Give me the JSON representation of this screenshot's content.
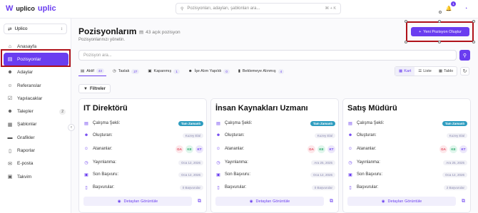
{
  "header": {
    "logo_text_1": "uplico",
    "logo_text_2": "uplic",
    "search_placeholder": "Pozisyonları, adayları, şablonları ara...",
    "search_shortcut": "⌘ + K",
    "notification_count": "1"
  },
  "sidebar": {
    "workspace": "Uplico",
    "items": [
      {
        "label": "Anasayfa",
        "icon": "home-icon"
      },
      {
        "label": "Pozisyonlar",
        "icon": "briefcase-icon"
      },
      {
        "label": "Adaylar",
        "icon": "user-icon"
      },
      {
        "label": "Referanslar",
        "icon": "users-icon"
      },
      {
        "label": "Yapılacaklar",
        "icon": "checklist-icon"
      },
      {
        "label": "Talepler",
        "icon": "user-plus-icon",
        "count": "2"
      },
      {
        "label": "Şablonlar",
        "icon": "template-icon"
      },
      {
        "label": "Grafikler",
        "icon": "chart-icon"
      },
      {
        "label": "Raporlar",
        "icon": "report-icon"
      },
      {
        "label": "E-posta",
        "icon": "mail-icon"
      },
      {
        "label": "Takvim",
        "icon": "calendar-icon"
      }
    ]
  },
  "main": {
    "title": "Pozisyonlarım",
    "open_count": "43 açık pozisyon",
    "subtitle": "Pozisyonlarınızı yönetin.",
    "new_button": "Yeni Pozisyon Oluştur",
    "search_placeholder": "Pozisyon ara...",
    "tabs": [
      {
        "label": "Aktif",
        "count": "43"
      },
      {
        "label": "Taslak",
        "count": "27"
      },
      {
        "label": "Kapanmış",
        "count": "1"
      },
      {
        "label": "İşe Alım Yapıldı",
        "count": "0"
      },
      {
        "label": "Beklemeye Alınmış",
        "count": "4"
      }
    ],
    "views": [
      "Kart",
      "Liste",
      "Tablo"
    ],
    "filters_label": "Filtreler"
  },
  "card_labels": {
    "calisma": "Çalışma Şekli:",
    "olusturan": "Oluşturan:",
    "atananlar": "Atananlar:",
    "yayinlanma": "Yayınlanma:",
    "son_basvuru": "Son Başvuru:",
    "basvurular": "Başvurular:",
    "details": "Detayları Görüntüle"
  },
  "cards": [
    {
      "title": "IT Direktörü",
      "work_type": "Tam Zamanlı",
      "creator": "Kuzey Elal",
      "assignees": [
        "GA",
        "KE",
        "KT"
      ],
      "published": "Oca 12, 2026",
      "deadline": "Oca 12, 2026",
      "applications": "0 Başvurular"
    },
    {
      "title": "İnsan Kaynakları Uzmanı",
      "work_type": "Tam Zamanlı",
      "creator": "Kuzey Elal",
      "assignees": [
        "GA",
        "KE",
        "KT"
      ],
      "published": "Ara 25, 2025",
      "deadline": "Oca 12, 2026",
      "applications": "0 Başvurular"
    },
    {
      "title": "Satış Müdürü",
      "work_type": "Tam Zamanlı",
      "creator": "Kuzey Elal",
      "assignees": [
        "GA",
        "KE",
        "KT"
      ],
      "published": "Ara 25, 2025",
      "deadline": "Oca 12, 2026",
      "applications": "2 Başvurular"
    }
  ]
}
